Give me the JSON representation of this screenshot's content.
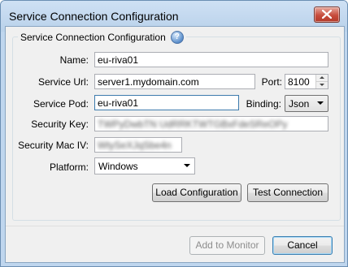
{
  "window": {
    "title": "Service Connection Configuration"
  },
  "group": {
    "title": "Service Connection Configuration"
  },
  "form": {
    "name": {
      "label": "Name:",
      "value": "eu-riva01"
    },
    "service_url": {
      "label": "Service Url:",
      "value": "server1.mydomain.com"
    },
    "port": {
      "label": "Port:",
      "value": "8100"
    },
    "service_pod": {
      "label": "Service Pod:",
      "value": "eu-riva01"
    },
    "binding": {
      "label": "Binding:",
      "value": "Json"
    },
    "security_key": {
      "label": "Security Key:",
      "value": "TWPyDwbTN UdRRKTWTGBxFdeSReOPy"
    },
    "security_mac_iv": {
      "label": "Security Mac IV:",
      "value": "WtySeXJqSbe4n"
    },
    "platform": {
      "label": "Platform:",
      "value": "Windows"
    }
  },
  "buttons": {
    "load_configuration": "Load Configuration",
    "test_connection": "Test Connection",
    "add_to_monitor": "Add to Monitor",
    "cancel": "Cancel"
  },
  "icons": {
    "help": "help-icon",
    "close": "close-icon"
  },
  "colors": {
    "titlebar": "#bfd6ee",
    "close_button": "#c74c3c",
    "focus_border": "#3d7bad"
  }
}
